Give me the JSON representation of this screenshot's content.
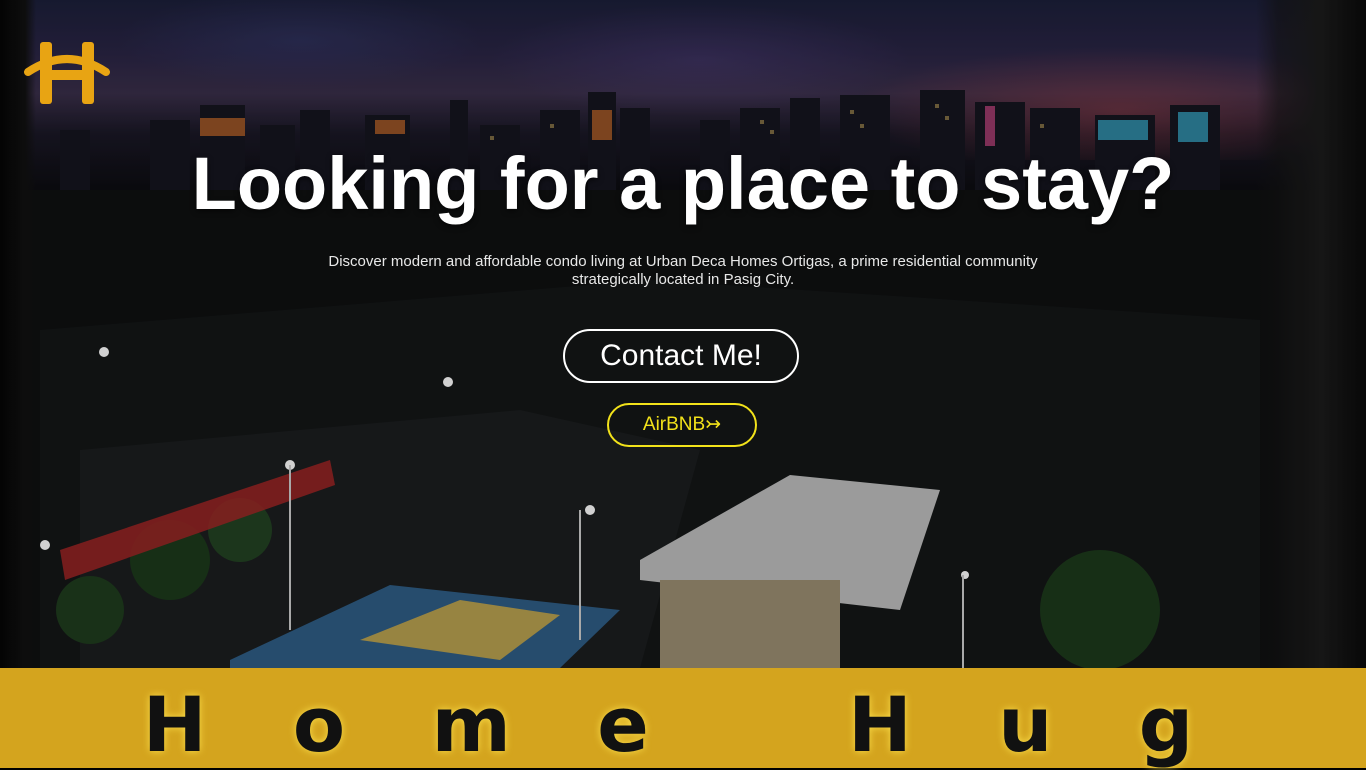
{
  "hero": {
    "headline": "Looking for a place to stay?",
    "subtext": "Discover modern and affordable condo living at Urban Deca Homes Ortigas, a prime residential community strategically located in Pasig City.",
    "contact_button": "Contact Me!",
    "airbnb_button": "AirBNB↣"
  },
  "brand": {
    "name": "H o m e   H u g"
  },
  "logo": {
    "icon": "home-hug-logo-icon"
  },
  "colors": {
    "accent_yellow": "#f2e21a",
    "footer_gold": "#d4a41e",
    "logo_gold": "#e8a413"
  }
}
